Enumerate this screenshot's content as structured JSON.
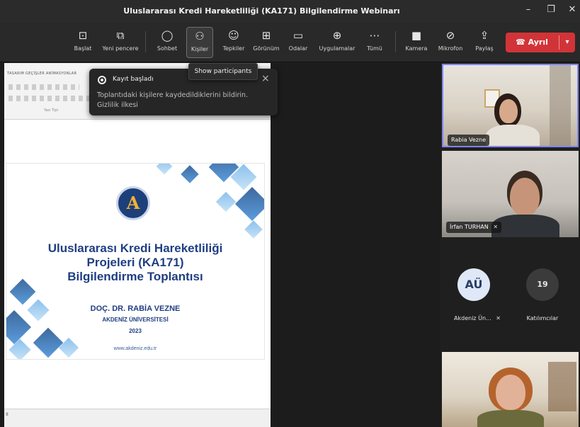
{
  "window": {
    "title": "Uluslararası Kredi Hareketliliği (KA171) Bilgilendirme Webinarı",
    "controls": {
      "minimize": "–",
      "maximize": "❐",
      "close": "✕"
    }
  },
  "toolbar": {
    "items": [
      {
        "label": "Başlat",
        "icon": "share-screen-icon"
      },
      {
        "label": "Yeni pencere",
        "icon": "new-window-icon"
      },
      {
        "label": "Sohbet",
        "icon": "chat-icon"
      },
      {
        "label": "Kişiler",
        "icon": "people-icon",
        "active": true
      },
      {
        "label": "Tepkiler",
        "icon": "reactions-icon"
      },
      {
        "label": "Görünüm",
        "icon": "view-icon"
      },
      {
        "label": "Odalar",
        "icon": "rooms-icon"
      },
      {
        "label": "Uygulamalar",
        "icon": "apps-icon"
      },
      {
        "label": "Tümü",
        "icon": "more-icon"
      },
      {
        "label": "Kamera",
        "icon": "camera-icon"
      },
      {
        "label": "Mikrofon",
        "icon": "mic-off-icon"
      },
      {
        "label": "Paylaş",
        "icon": "share-icon"
      }
    ],
    "leave_label": "Ayrıl",
    "leave_color": "#d13438"
  },
  "tooltip": {
    "text": "Show participants"
  },
  "notification": {
    "title": "Kayıt başladı",
    "body_line1": "Toplantıdaki kişilere kaydedildiklerini bildirin.",
    "body_line2": "Gizlilik ilkesi",
    "close": "×"
  },
  "presentation": {
    "ribbon_tabs": "TASARIM  GEÇİŞLER  ANİMASYONLAR",
    "font_group_label": "Yazı Tipi",
    "slide": {
      "title_lines": [
        "Uluslararası Kredi Hareketliliği",
        "Projeleri (KA171)",
        "Bilgilendirme Toplantısı"
      ],
      "author": "DOÇ. DR. RABİA VEZNE",
      "university": "AKDENİZ ÜNİVERSİTESİ",
      "year": "2023",
      "website": "www.akdeniz.edu.tr",
      "title_color": "#1f3e82"
    },
    "status_bar": "8"
  },
  "participants": {
    "tiles": [
      {
        "name": "Rabia Vezne",
        "mic_off": false,
        "selected": true
      },
      {
        "name": "İrfan TURHAN",
        "mic_off": true,
        "selected": false
      },
      {
        "name": "",
        "mic_off": false,
        "selected": false
      }
    ],
    "avatar_row": [
      {
        "initials": "AÜ",
        "name": "Akdeniz Ün...",
        "mic_off": true
      },
      {
        "initials": "19",
        "name": "Katılımcılar",
        "mic_off": false
      }
    ],
    "selected_color": "#7f85f5"
  }
}
